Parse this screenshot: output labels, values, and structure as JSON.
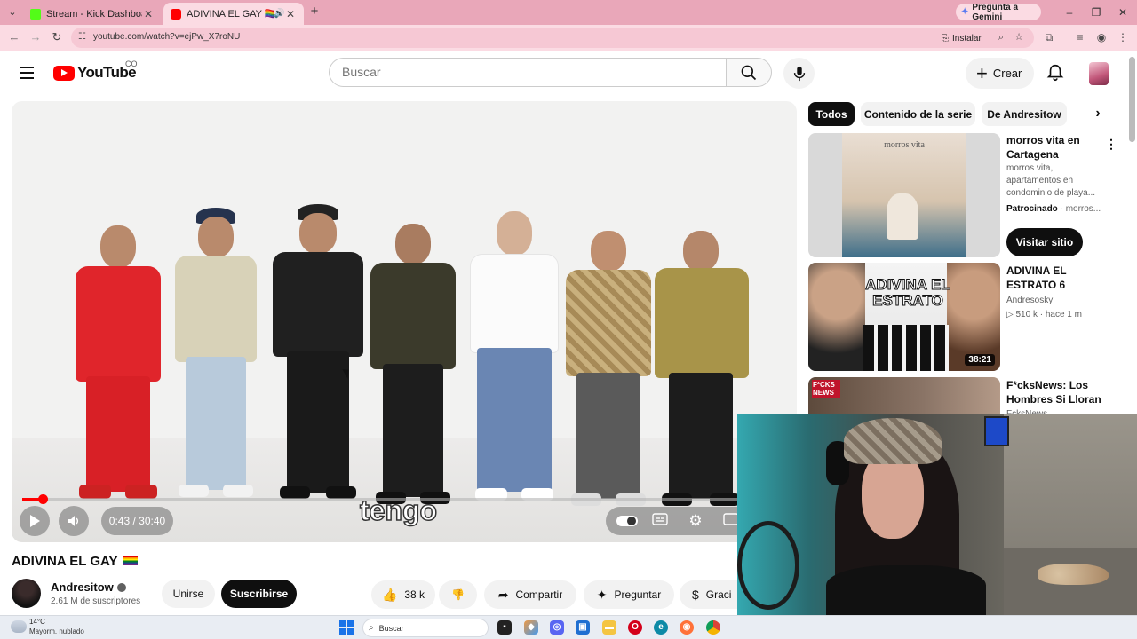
{
  "browser": {
    "tabs": [
      {
        "title": "Stream - Kick Dashboard",
        "favicon_color": "#53fc18"
      },
      {
        "title": "ADIVINA EL GAY 🏳️‍🌈 - YouTu",
        "favicon_color": "#ff0000"
      }
    ],
    "gemini_button": "Pregunta a Gemini",
    "url": "youtube.com/watch?v=ejPw_X7roNU",
    "install_label": "Instalar"
  },
  "youtube": {
    "logo_text": "YouTube",
    "country_code": "CO",
    "search_placeholder": "Buscar",
    "create_label": "Crear"
  },
  "player": {
    "subtitle_text": "tengo",
    "time": "0:43 / 30:40",
    "progress_fraction": 0.0234
  },
  "video": {
    "title": "ADIVINA EL GAY",
    "channel_name": "Andresitow",
    "subscribers": "2.61 M de suscriptores",
    "join_label": "Unirse",
    "subscribe_label": "Suscribirse",
    "likes": "38 k",
    "share_label": "Compartir",
    "ask_label": "Preguntar",
    "thanks_label": "Graci"
  },
  "sidebar": {
    "chips": [
      "Todos",
      "Contenido de la serie",
      "De Andresitow"
    ],
    "ad": {
      "title": "morros vita en Cartagena",
      "description": "morros vita, apartamentos en condominio de playa...",
      "sponsored_label": "Patrocinado",
      "sponsor_name": "morros...",
      "thumb_text": "morros vita",
      "cta_label": "Visitar sitio"
    },
    "recommendations": [
      {
        "title": "ADIVINA EL ESTRATO 6",
        "channel": "Andresosky",
        "views": "510 k",
        "age": "hace 1 m",
        "duration": "38:21",
        "thumb_text": "ADIVINA EL ESTRATO"
      },
      {
        "title": "F*cksNews: Los Hombres Si Lloran",
        "channel": "FcksNews",
        "thumb_text": "F*CKS NEWS"
      }
    ]
  },
  "taskbar": {
    "temperature": "14°C",
    "weather": "Mayorm. nublado",
    "search_placeholder": "Buscar"
  },
  "colors": {
    "chrome_tab_bar": "#e9a7b9",
    "chrome_toolbar": "#fbdbe3",
    "youtube_red": "#ff0000",
    "dark_button": "#0f0f0f"
  }
}
